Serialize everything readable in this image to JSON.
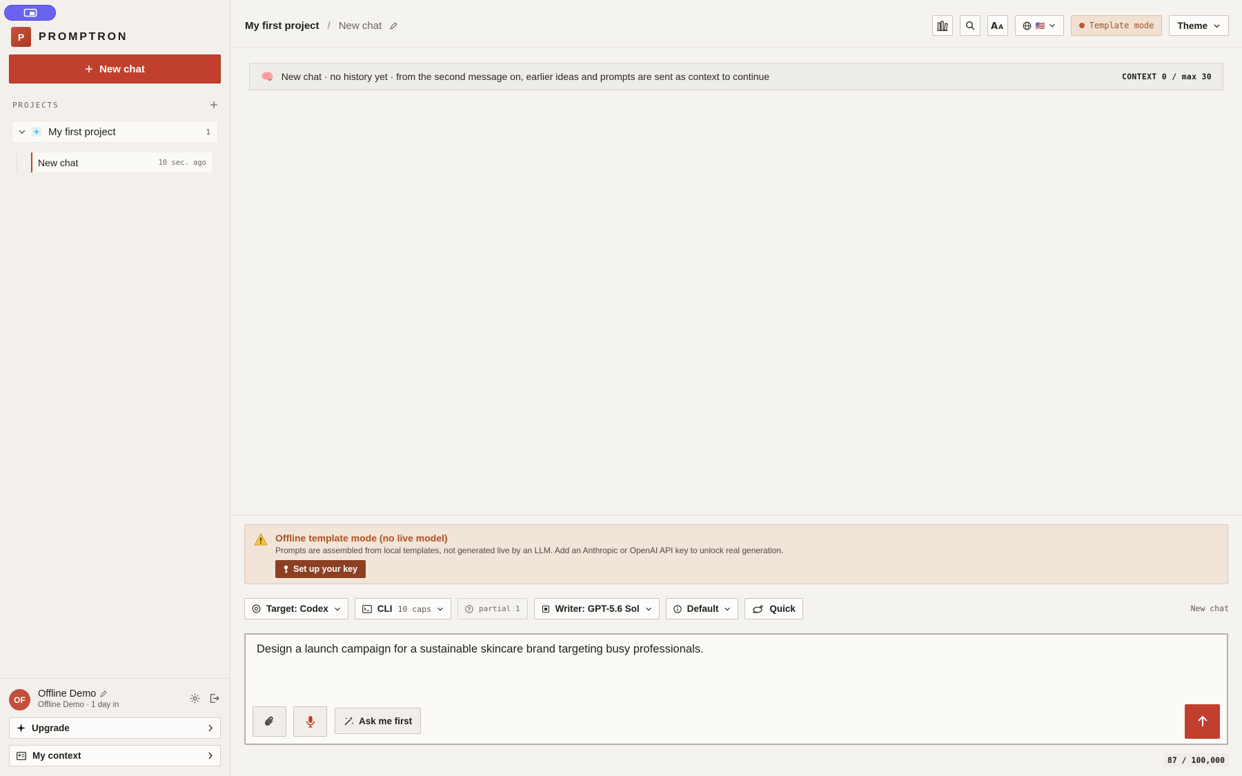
{
  "app": {
    "name": "PROMPTRON",
    "logo_letter": "P",
    "accent": "#c0402d"
  },
  "sidebar": {
    "new_chat_label": "New chat",
    "projects_label": "PROJECTS",
    "projects": [
      {
        "name": "My first project",
        "count": "1",
        "chats": [
          {
            "title": "New chat",
            "ago": "10 sec. ago"
          }
        ]
      }
    ],
    "user": {
      "initials": "OF",
      "name": "Offline Demo",
      "sub": "Offline Demo · 1 day in"
    },
    "upgrade_label": "Upgrade",
    "context_label": "My context"
  },
  "header": {
    "project": "My first project",
    "separator": "/",
    "chat": "New chat",
    "template_mode": "Template mode",
    "theme_label": "Theme",
    "flag": "🇺🇸"
  },
  "context_bar": {
    "icon": "🧠",
    "message": "New chat · no history yet · from the second message on, earlier ideas and prompts are sent as context to continue",
    "context": "CONTEXT 0 / max 30"
  },
  "warning": {
    "title": "Offline template mode (no live model)",
    "text": "Prompts are assembled from local templates, not generated live by an LLM. Add an Anthropic or OpenAI API key to unlock real generation.",
    "button": "Set up your key"
  },
  "chips": {
    "target": "Target: Codex",
    "cli": "CLI",
    "cli_caps": "10 caps",
    "partial": "partial 1",
    "writer": "Writer: GPT-5.6 Sol",
    "mode": "Default",
    "speed": "Quick",
    "right_label": "New chat"
  },
  "composer": {
    "text": "Design a launch campaign for a sustainable skincare brand targeting busy professionals.",
    "ask_label": "Ask me first",
    "counter": "87 / 100,000"
  }
}
